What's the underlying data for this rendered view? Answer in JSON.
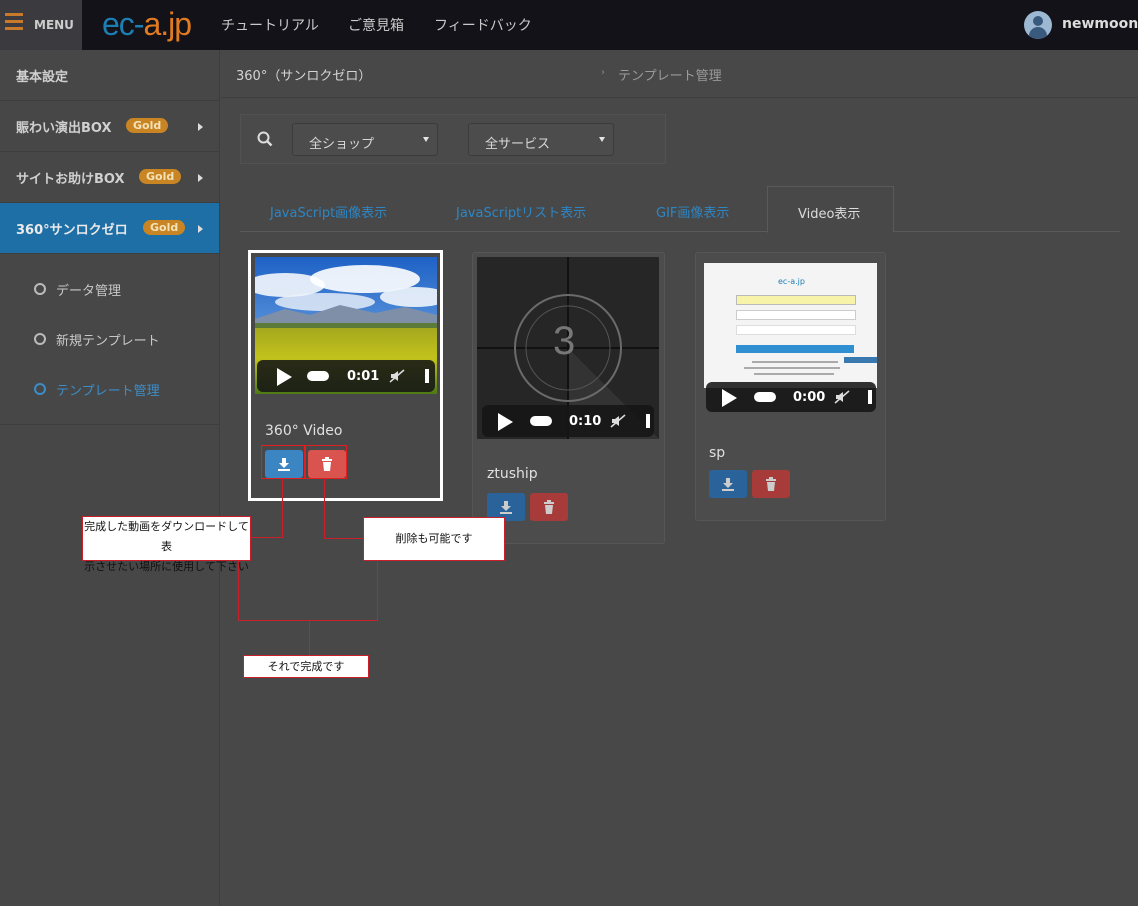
{
  "header": {
    "menu_label": "MENU",
    "logo": {
      "part1": "ec-",
      "part2": "a.",
      "part3": "jp"
    },
    "nav": [
      "チュートリアル",
      "ご意見箱",
      "フィードバック"
    ],
    "username": "newmoon"
  },
  "sidebar": {
    "items": [
      {
        "label": "基本設定",
        "badge": ""
      },
      {
        "label": "賑わい演出BOX",
        "badge": "Gold"
      },
      {
        "label": "サイトお助けBOX",
        "badge": "Gold"
      },
      {
        "label": "360°サンロクゼロ",
        "badge": "Gold"
      }
    ],
    "sub_items": [
      "データ管理",
      "新規テンプレート",
      "テンプレート管理"
    ]
  },
  "breadcrumb": {
    "root": "360°（サンロクゼロ）",
    "separator": "›",
    "current": "テンプレート管理"
  },
  "filters": {
    "shop": "全ショップ",
    "service": "全サービス"
  },
  "tabs": [
    "JavaScript画像表示",
    "JavaScriptリスト表示",
    "GIF画像表示",
    "Video表示"
  ],
  "cards": [
    {
      "title": "360° Video",
      "time": "0:01"
    },
    {
      "title": "ztuship",
      "time": "0:10",
      "countdown": "3"
    },
    {
      "title": "sp",
      "time": "0:00",
      "preview_logo": "ec-a.jp"
    }
  ],
  "annotations": {
    "download": [
      "完成した動画をダウンロードして表",
      "示させたい場所に使用して下さい"
    ],
    "delete": "削除も可能です",
    "done": "それで完成です"
  },
  "colors": {
    "accent": "#1d6fa6",
    "gold": "#c98523",
    "download": "#3a85c2",
    "delete": "#d9534f",
    "annotation": "#c8202b"
  }
}
